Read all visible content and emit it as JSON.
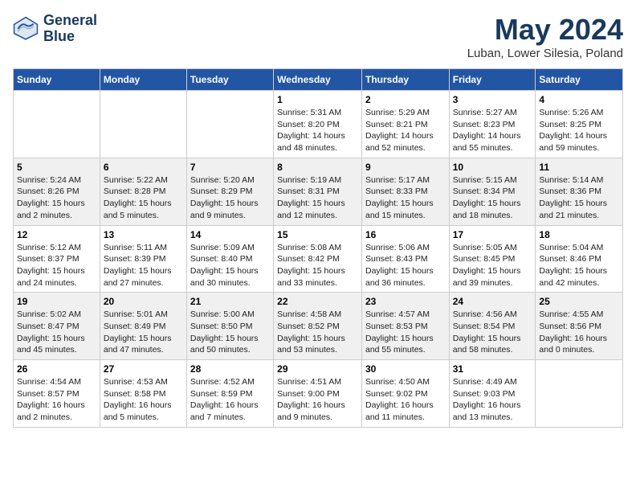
{
  "header": {
    "logo_line1": "General",
    "logo_line2": "Blue",
    "month_title": "May 2024",
    "location": "Luban, Lower Silesia, Poland"
  },
  "calendar": {
    "days_of_week": [
      "Sunday",
      "Monday",
      "Tuesday",
      "Wednesday",
      "Thursday",
      "Friday",
      "Saturday"
    ],
    "weeks": [
      [
        {
          "day": "",
          "info": ""
        },
        {
          "day": "",
          "info": ""
        },
        {
          "day": "",
          "info": ""
        },
        {
          "day": "1",
          "info": "Sunrise: 5:31 AM\nSunset: 8:20 PM\nDaylight: 14 hours\nand 48 minutes."
        },
        {
          "day": "2",
          "info": "Sunrise: 5:29 AM\nSunset: 8:21 PM\nDaylight: 14 hours\nand 52 minutes."
        },
        {
          "day": "3",
          "info": "Sunrise: 5:27 AM\nSunset: 8:23 PM\nDaylight: 14 hours\nand 55 minutes."
        },
        {
          "day": "4",
          "info": "Sunrise: 5:26 AM\nSunset: 8:25 PM\nDaylight: 14 hours\nand 59 minutes."
        }
      ],
      [
        {
          "day": "5",
          "info": "Sunrise: 5:24 AM\nSunset: 8:26 PM\nDaylight: 15 hours\nand 2 minutes."
        },
        {
          "day": "6",
          "info": "Sunrise: 5:22 AM\nSunset: 8:28 PM\nDaylight: 15 hours\nand 5 minutes."
        },
        {
          "day": "7",
          "info": "Sunrise: 5:20 AM\nSunset: 8:29 PM\nDaylight: 15 hours\nand 9 minutes."
        },
        {
          "day": "8",
          "info": "Sunrise: 5:19 AM\nSunset: 8:31 PM\nDaylight: 15 hours\nand 12 minutes."
        },
        {
          "day": "9",
          "info": "Sunrise: 5:17 AM\nSunset: 8:33 PM\nDaylight: 15 hours\nand 15 minutes."
        },
        {
          "day": "10",
          "info": "Sunrise: 5:15 AM\nSunset: 8:34 PM\nDaylight: 15 hours\nand 18 minutes."
        },
        {
          "day": "11",
          "info": "Sunrise: 5:14 AM\nSunset: 8:36 PM\nDaylight: 15 hours\nand 21 minutes."
        }
      ],
      [
        {
          "day": "12",
          "info": "Sunrise: 5:12 AM\nSunset: 8:37 PM\nDaylight: 15 hours\nand 24 minutes."
        },
        {
          "day": "13",
          "info": "Sunrise: 5:11 AM\nSunset: 8:39 PM\nDaylight: 15 hours\nand 27 minutes."
        },
        {
          "day": "14",
          "info": "Sunrise: 5:09 AM\nSunset: 8:40 PM\nDaylight: 15 hours\nand 30 minutes."
        },
        {
          "day": "15",
          "info": "Sunrise: 5:08 AM\nSunset: 8:42 PM\nDaylight: 15 hours\nand 33 minutes."
        },
        {
          "day": "16",
          "info": "Sunrise: 5:06 AM\nSunset: 8:43 PM\nDaylight: 15 hours\nand 36 minutes."
        },
        {
          "day": "17",
          "info": "Sunrise: 5:05 AM\nSunset: 8:45 PM\nDaylight: 15 hours\nand 39 minutes."
        },
        {
          "day": "18",
          "info": "Sunrise: 5:04 AM\nSunset: 8:46 PM\nDaylight: 15 hours\nand 42 minutes."
        }
      ],
      [
        {
          "day": "19",
          "info": "Sunrise: 5:02 AM\nSunset: 8:47 PM\nDaylight: 15 hours\nand 45 minutes."
        },
        {
          "day": "20",
          "info": "Sunrise: 5:01 AM\nSunset: 8:49 PM\nDaylight: 15 hours\nand 47 minutes."
        },
        {
          "day": "21",
          "info": "Sunrise: 5:00 AM\nSunset: 8:50 PM\nDaylight: 15 hours\nand 50 minutes."
        },
        {
          "day": "22",
          "info": "Sunrise: 4:58 AM\nSunset: 8:52 PM\nDaylight: 15 hours\nand 53 minutes."
        },
        {
          "day": "23",
          "info": "Sunrise: 4:57 AM\nSunset: 8:53 PM\nDaylight: 15 hours\nand 55 minutes."
        },
        {
          "day": "24",
          "info": "Sunrise: 4:56 AM\nSunset: 8:54 PM\nDaylight: 15 hours\nand 58 minutes."
        },
        {
          "day": "25",
          "info": "Sunrise: 4:55 AM\nSunset: 8:56 PM\nDaylight: 16 hours\nand 0 minutes."
        }
      ],
      [
        {
          "day": "26",
          "info": "Sunrise: 4:54 AM\nSunset: 8:57 PM\nDaylight: 16 hours\nand 2 minutes."
        },
        {
          "day": "27",
          "info": "Sunrise: 4:53 AM\nSunset: 8:58 PM\nDaylight: 16 hours\nand 5 minutes."
        },
        {
          "day": "28",
          "info": "Sunrise: 4:52 AM\nSunset: 8:59 PM\nDaylight: 16 hours\nand 7 minutes."
        },
        {
          "day": "29",
          "info": "Sunrise: 4:51 AM\nSunset: 9:00 PM\nDaylight: 16 hours\nand 9 minutes."
        },
        {
          "day": "30",
          "info": "Sunrise: 4:50 AM\nSunset: 9:02 PM\nDaylight: 16 hours\nand 11 minutes."
        },
        {
          "day": "31",
          "info": "Sunrise: 4:49 AM\nSunset: 9:03 PM\nDaylight: 16 hours\nand 13 minutes."
        },
        {
          "day": "",
          "info": ""
        }
      ]
    ]
  }
}
